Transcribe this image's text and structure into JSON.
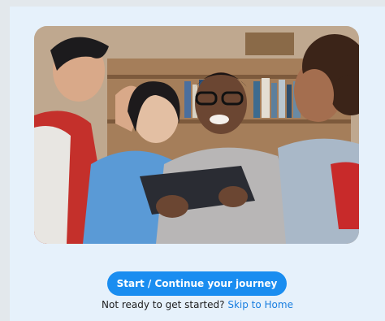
{
  "hero": {
    "image_alt": "Four smiling students looking at a tablet in front of a bookshelf"
  },
  "cta": {
    "label": "Start / Continue your journey"
  },
  "footer": {
    "prompt": "Not ready to get started?",
    "link": "Skip to Home"
  },
  "colors": {
    "card_background": "#e6f1fb",
    "accent": "#1a8df0",
    "link": "#1a7fe0"
  }
}
